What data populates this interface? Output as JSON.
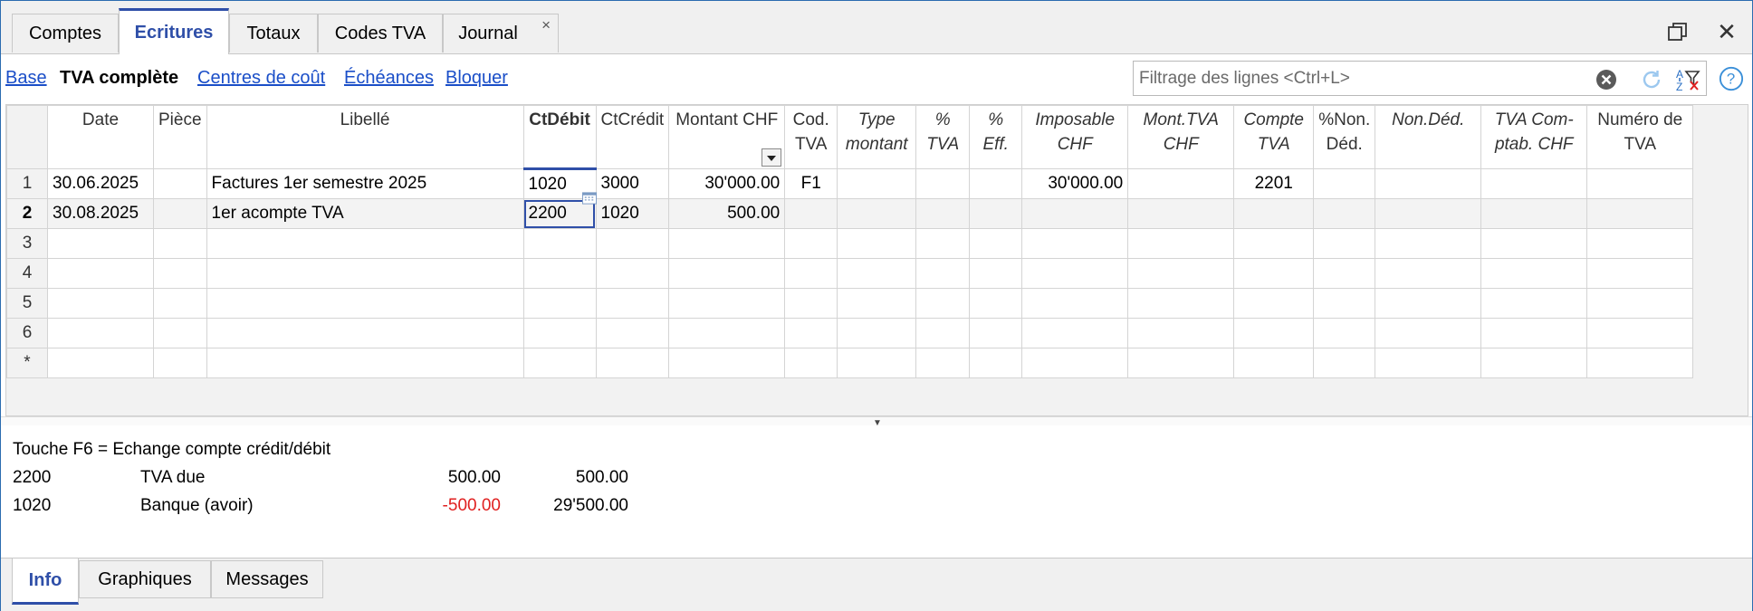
{
  "tabs": [
    {
      "label": "Comptes"
    },
    {
      "label": "Ecritures"
    },
    {
      "label": "Totaux"
    },
    {
      "label": "Codes TVA"
    },
    {
      "label": "Journal"
    }
  ],
  "active_tab": "Ecritures",
  "tab_close_glyph": "×",
  "window": {
    "restore_icon": "restore-icon",
    "close_icon": "close-icon",
    "close_glyph": "✕"
  },
  "views": [
    {
      "label": "Base"
    },
    {
      "label": "TVA complète"
    },
    {
      "label": "Centres de coût"
    },
    {
      "label": "Échéances"
    },
    {
      "label": "Bloquer"
    }
  ],
  "current_view": "TVA complète",
  "filter": {
    "placeholder": "Filtrage des lignes <Ctrl+L>",
    "value": ""
  },
  "grid": {
    "columns": [
      {
        "label": "",
        "key": "rn"
      },
      {
        "label": "Date"
      },
      {
        "label": "Pièce"
      },
      {
        "label": "Libellé"
      },
      {
        "label": "CtDébit"
      },
      {
        "label": "CtCrédit"
      },
      {
        "label": "Montant CHF"
      },
      {
        "label": "Cod. TVA"
      },
      {
        "label": "Type montant"
      },
      {
        "label": "% TVA"
      },
      {
        "label": "% Eff."
      },
      {
        "label": "Imposable CHF"
      },
      {
        "label": "Mont.TVA CHF"
      },
      {
        "label": "Compte TVA"
      },
      {
        "label": "%Non. Déd."
      },
      {
        "label": "Non.Déd."
      },
      {
        "label": "TVA Com-ptab. CHF"
      },
      {
        "label": "Numéro de TVA"
      }
    ],
    "rows": [
      {
        "rn": "1",
        "date": "30.06.2025",
        "piece": "",
        "libelle": "Factures 1er semestre 2025",
        "ctdebit": "1020",
        "ctcredit": "3000",
        "montant": "30'000.00",
        "codtva": "F1",
        "imposable": "30'000.00",
        "comptetva": "2201"
      },
      {
        "rn": "2",
        "date": "30.08.2025",
        "piece": "",
        "libelle": "1er acompte TVA",
        "ctdebit": "2200",
        "ctcredit": "1020",
        "montant": "500.00",
        "codtva": "",
        "imposable": "",
        "comptetva": ""
      },
      {
        "rn": "3"
      },
      {
        "rn": "4"
      },
      {
        "rn": "5"
      },
      {
        "rn": "6"
      },
      {
        "rn": "*"
      }
    ]
  },
  "info": {
    "hint": "Touche F6 = Echange compte crédit/débit",
    "lines": [
      {
        "account": "2200",
        "description": "TVA due",
        "amount": "500.00",
        "balance": "500.00",
        "amount_color": "#000000"
      },
      {
        "account": "1020",
        "description": "Banque (avoir)",
        "amount": "-500.00",
        "balance": "29'500.00",
        "amount_color": "#e02020"
      }
    ]
  },
  "bottom_tabs": [
    {
      "label": "Info"
    },
    {
      "label": "Graphiques"
    },
    {
      "label": "Messages"
    }
  ],
  "active_bottom_tab": "Info",
  "colors": {
    "accent": "#2f4fa8",
    "link": "#1a4ec8",
    "negative": "#e02020",
    "window_border": "#2b6cb0"
  }
}
